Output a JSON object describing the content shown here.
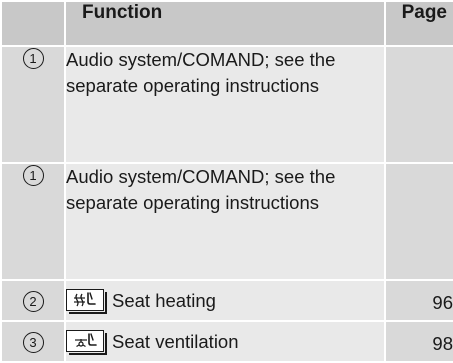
{
  "table": {
    "headers": {
      "number": "",
      "function": "Function",
      "page": "Page"
    },
    "rows": [
      {
        "number": "1",
        "function": "Audio system/COMAND; see the separate operating instructions",
        "page": ""
      },
      {
        "number": "1",
        "function": "Audio system/COMAND; see the separate operating instructions",
        "page": ""
      },
      {
        "number": "2",
        "icon": "seat-heating-icon",
        "function": "Seat heating",
        "page": "96"
      },
      {
        "number": "3",
        "icon": "seat-ventilation-icon",
        "function": "Seat ventilation",
        "page": "98"
      }
    ]
  },
  "colors": {
    "header_bg": "#c8c8c8",
    "number_cell_bg": "#d9d9d9",
    "function_cell_bg": "#e9e9e9",
    "page_cell_bg": "#d9d9d9",
    "text": "#1a1a1a"
  }
}
